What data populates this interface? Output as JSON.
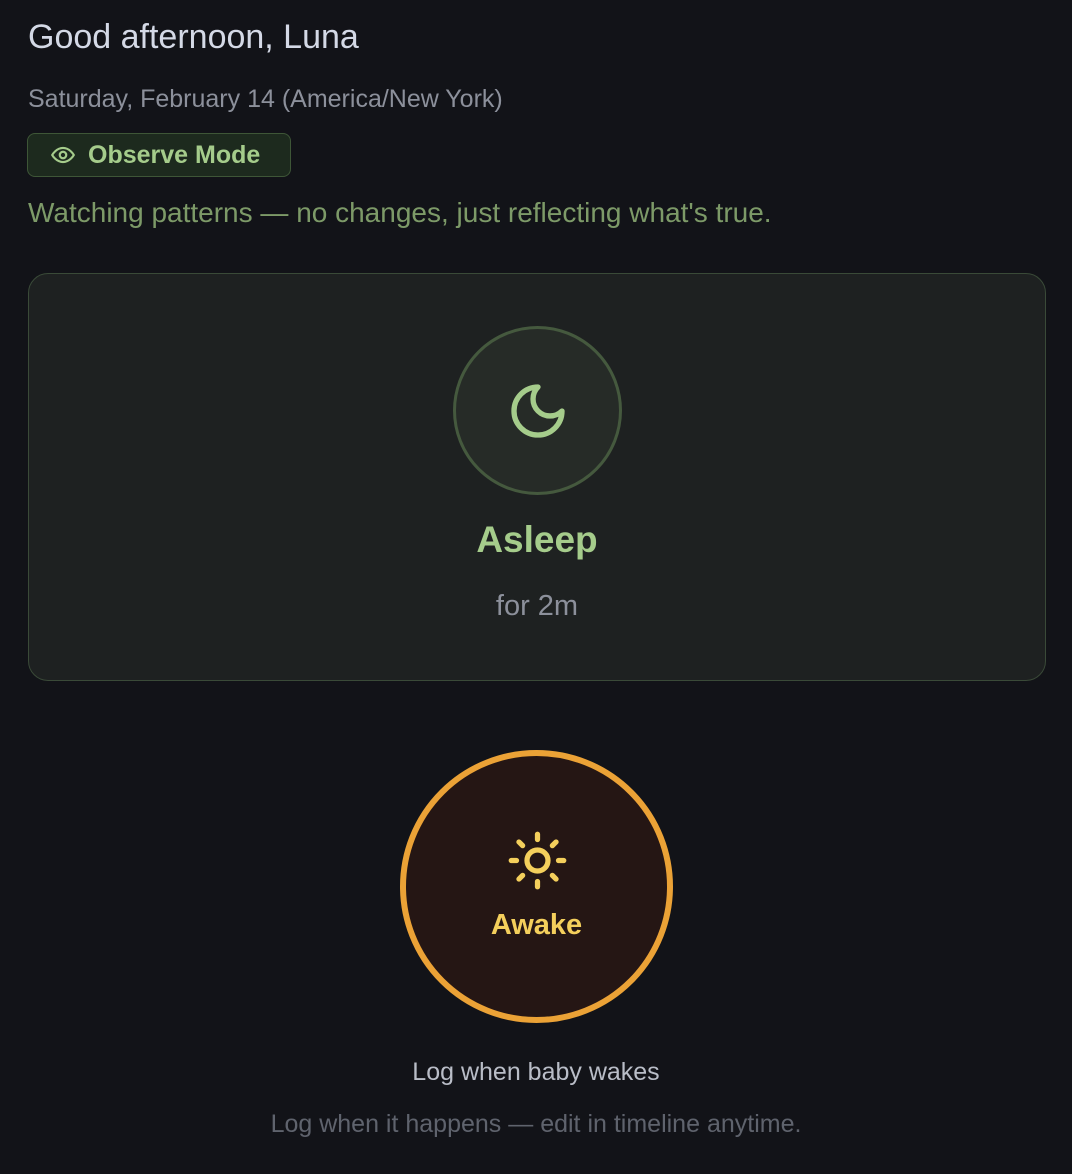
{
  "header": {
    "greeting": "Good afternoon, Luna",
    "date": "Saturday, February 14 (America/New York)"
  },
  "mode": {
    "icon": "eye-icon",
    "label": "Observe Mode",
    "description": "Watching patterns — no changes, just reflecting what's true."
  },
  "status": {
    "icon": "moon-icon",
    "state": "Asleep",
    "duration": "for 2m"
  },
  "action": {
    "icon": "sun-icon",
    "label": "Awake",
    "hint": "Log when baby wakes",
    "subhint": "Log when it happens — edit in timeline anytime."
  },
  "colors": {
    "background": "#121318",
    "sleep_accent": "#a5cc8b",
    "awake_accent": "#eba236",
    "awake_text": "#f4cf5c"
  }
}
